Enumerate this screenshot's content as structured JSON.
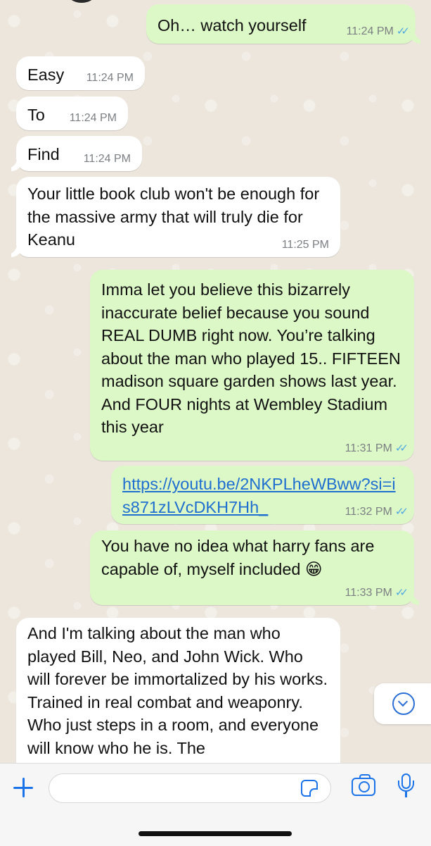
{
  "messages": [
    {
      "direction": "out",
      "text": "Oh… watch yourself",
      "time": "11:24 PM",
      "read": true
    },
    {
      "direction": "in",
      "text": "Easy",
      "time": "11:24 PM"
    },
    {
      "direction": "in",
      "text": "To",
      "time": "11:24 PM"
    },
    {
      "direction": "in",
      "text": "Find",
      "time": "11:24 PM"
    },
    {
      "direction": "in",
      "text": "Your little book club won't be enough for the massive army that will truly die for Keanu",
      "time": "11:25 PM"
    },
    {
      "direction": "out",
      "text": "Imma let you believe this bizarrely inaccurate belief because you sound REAL DUMB right now. You’re talking about the man who played 15.. FIFTEEN madison square garden shows last year. And FOUR nights at Wembley Stadium this year",
      "time": "11:31 PM",
      "read": true
    },
    {
      "direction": "out",
      "link": "https://youtu.be/2NKPLheWBww?si=is871zLVcDKH7Hh_",
      "time": "11:32 PM",
      "read": true
    },
    {
      "direction": "out",
      "text": "You have no idea what harry fans are capable of, myself included 😁",
      "time": "11:33 PM",
      "read": true
    },
    {
      "direction": "in",
      "text": "And I'm talking about the man who played Bill, Neo, and John Wick. Who will forever be immortalized by his works. Trained in real combat and weaponry. Who just steps in a room, and everyone will know who he is. The"
    }
  ],
  "read_ticks": "✓✓",
  "composer": {
    "placeholder": ""
  },
  "icons": {
    "attach": "plus-icon",
    "sticker": "sticker-icon",
    "camera": "camera-icon",
    "mic": "microphone-icon",
    "scroll": "chevron-down-icon"
  },
  "colors": {
    "incoming": "#ffffff",
    "outgoing": "#dcf8c6",
    "accent": "#1a73e8",
    "read_receipt": "#4fa8e3"
  }
}
